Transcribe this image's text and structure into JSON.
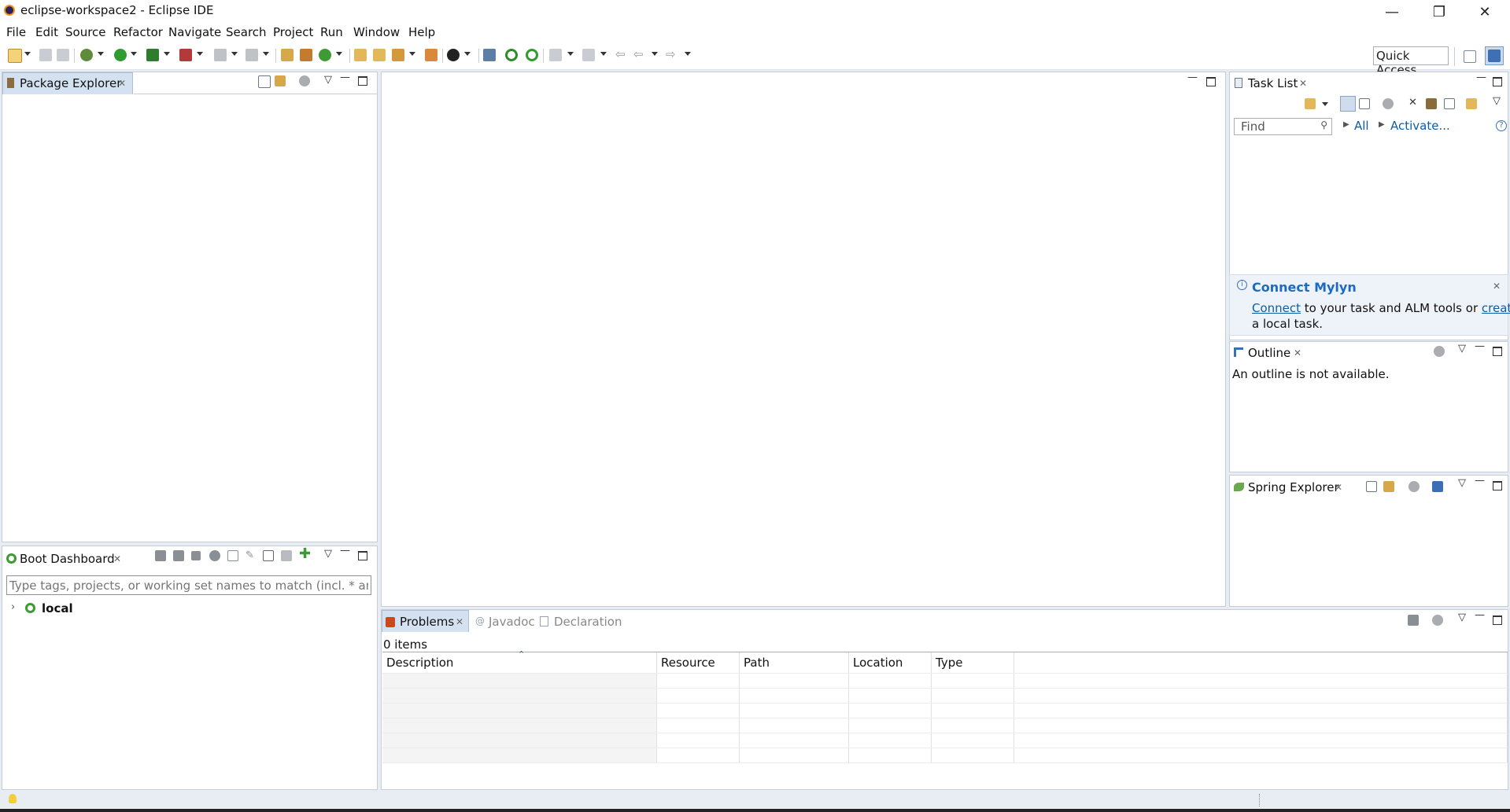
{
  "window": {
    "title": "eclipse-workspace2 - Eclipse IDE",
    "minimize": "—",
    "restore": "❐",
    "close": "✕"
  },
  "menu": [
    "File",
    "Edit",
    "Source",
    "Refactor",
    "Navigate",
    "Search",
    "Project",
    "Run",
    "Window",
    "Help"
  ],
  "toolbar": {
    "quick_access": "Quick Access"
  },
  "package_explorer": {
    "title": "Package Explorer"
  },
  "boot_dashboard": {
    "title": "Boot Dashboard",
    "filter_placeholder": "Type tags, projects, or working set names to match (incl. * and ? wi",
    "tree_items": [
      {
        "label": "local"
      }
    ]
  },
  "task_list": {
    "title": "Task List",
    "find_placeholder": "Find",
    "all_label": "All",
    "activate_label": "Activate...",
    "connect_mylyn": {
      "title": "Connect Mylyn",
      "connect_link": "Connect",
      "middle_text": " to your task and ALM tools or ",
      "create_link": "create",
      "tail_text": "a local task."
    }
  },
  "outline": {
    "title": "Outline",
    "message": "An outline is not available."
  },
  "spring_explorer": {
    "title": "Spring Explorer"
  },
  "bottom_tabs": [
    {
      "label": "Problems",
      "active": true
    },
    {
      "label": "Javadoc",
      "active": false
    },
    {
      "label": "Declaration",
      "active": false
    }
  ],
  "problems": {
    "count": "0 items",
    "columns": [
      "Description",
      "Resource",
      "Path",
      "Location",
      "Type"
    ],
    "empty_rows": 6
  },
  "colors": {
    "accent": "#0c5da5",
    "active_tab": "#d4e1f1",
    "spring_green": "#3c9c33",
    "background": "#e8edf3"
  }
}
